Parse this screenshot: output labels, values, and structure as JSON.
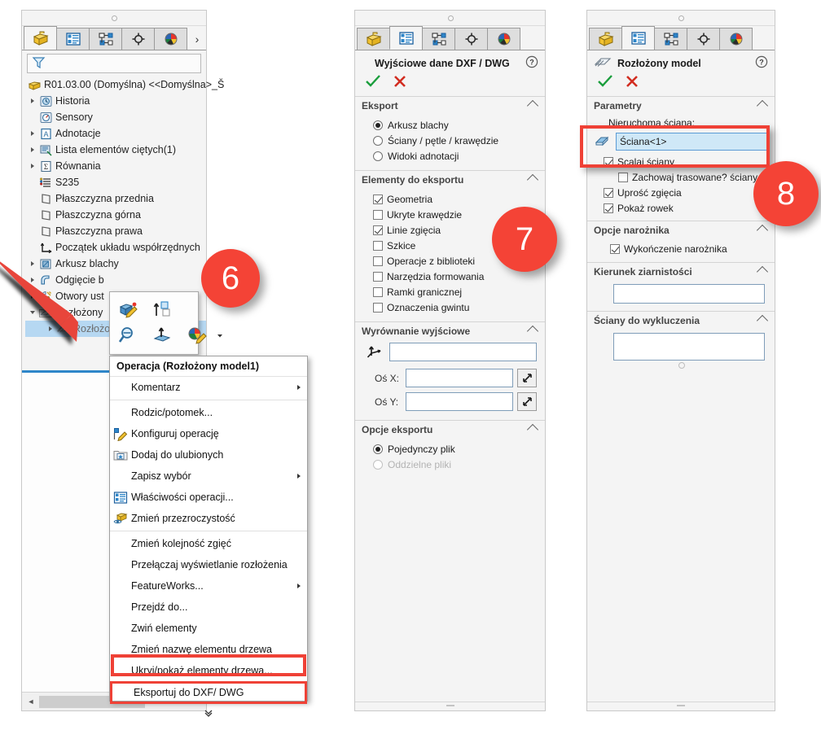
{
  "tree_panel": {
    "tabs": [
      {
        "name": "feature-manager-tab",
        "icon": "feature-tree-icon",
        "active": true
      },
      {
        "name": "property-manager-tab",
        "icon": "property-manager-icon",
        "active": false
      },
      {
        "name": "configuration-manager-tab",
        "icon": "configuration-manager-icon",
        "active": false
      },
      {
        "name": "dimxpert-manager-tab",
        "icon": "dimxpert-icon",
        "active": false
      },
      {
        "name": "display-manager-tab",
        "icon": "display-manager-icon",
        "active": false
      }
    ],
    "more_label": "›",
    "filter_placeholder": "",
    "root_label": "R01.03.00 (Domyślna) <<Domyślna>_Š",
    "items": [
      {
        "label": "Historia",
        "icon": "history-icon",
        "expandable": true,
        "indent": 0
      },
      {
        "label": "Sensory",
        "icon": "sensors-icon",
        "expandable": false,
        "indent": 0
      },
      {
        "label": "Adnotacje",
        "icon": "annotations-icon",
        "expandable": true,
        "indent": 0
      },
      {
        "label": "Lista elementów ciętych(1)",
        "icon": "cut-list-icon",
        "expandable": true,
        "indent": 0
      },
      {
        "label": "Równania",
        "icon": "equations-icon",
        "expandable": true,
        "indent": 0
      },
      {
        "label": "S235",
        "icon": "material-icon",
        "expandable": false,
        "indent": 0
      },
      {
        "label": "Płaszczyzna przednia",
        "icon": "plane-icon",
        "expandable": false,
        "indent": 0
      },
      {
        "label": "Płaszczyzna górna",
        "icon": "plane-icon",
        "expandable": false,
        "indent": 0
      },
      {
        "label": "Płaszczyzna prawa",
        "icon": "plane-icon",
        "expandable": false,
        "indent": 0
      },
      {
        "label": "Początek układu współrzędnych",
        "icon": "origin-icon",
        "expandable": false,
        "indent": 0
      },
      {
        "label": "Arkusz blachy",
        "icon": "sheet-metal-icon",
        "expandable": true,
        "indent": 0
      },
      {
        "label": "Odgięcie b",
        "icon": "base-flange-icon",
        "expandable": true,
        "indent": 0
      },
      {
        "label": "Otwory ust",
        "icon": "hole-wizard-icon",
        "expandable": true,
        "indent": 0
      },
      {
        "label": "Rozłożony",
        "icon": "flat-pattern-folder-icon",
        "expandable": true,
        "expanded": true,
        "indent": 0
      },
      {
        "label": "Rozłożony model1",
        "icon": "flat-pattern-icon",
        "expandable": true,
        "indent": 1,
        "selected": true
      }
    ]
  },
  "mini_toolbar": {
    "buttons": [
      {
        "name": "edit-feature-button",
        "icon": "edit-feature-icon"
      },
      {
        "name": "parent-child-button",
        "icon": "parent-child-icon"
      },
      {
        "name": "zoom-to-selection-button",
        "icon": "zoom-to-selection-icon"
      },
      {
        "name": "normal-to-button",
        "icon": "normal-to-icon"
      },
      {
        "name": "appearance-button",
        "icon": "appearance-icon"
      },
      {
        "name": "appearance-dropdown-button",
        "icon": "chevron-down-icon"
      }
    ]
  },
  "context_menu": {
    "header": "Operacja (Rozłożony model1)",
    "items": [
      {
        "label": "Komentarz",
        "icon": null,
        "submenu": true
      },
      {
        "label": "Rodzic/potomek...",
        "icon": null,
        "submenu": false,
        "sep_before": true
      },
      {
        "label": "Konfiguruj operację",
        "icon": "configure-feature-icon",
        "submenu": false
      },
      {
        "label": "Dodaj do ulubionych",
        "icon": "add-favorite-icon",
        "submenu": false
      },
      {
        "label": "Zapisz wybór",
        "icon": null,
        "submenu": true
      },
      {
        "label": "Właściwości operacji...",
        "icon": "feature-properties-icon",
        "submenu": false
      },
      {
        "label": "Zmień przezroczystość",
        "icon": "change-transparency-icon",
        "submenu": false
      },
      {
        "label": "Zmień kolejność zgięć",
        "icon": null,
        "submenu": false,
        "sep_before": true
      },
      {
        "label": "Przełączaj wyświetlanie rozłożenia",
        "icon": null,
        "submenu": false
      },
      {
        "label": "FeatureWorks...",
        "icon": null,
        "submenu": true
      },
      {
        "label": "Przejdź do...",
        "icon": null,
        "submenu": false
      },
      {
        "label": "Zwiń elementy",
        "icon": null,
        "submenu": false
      },
      {
        "label": "Zmień nazwę elementu drzewa",
        "icon": null,
        "submenu": false
      },
      {
        "label": "Ukryj/pokaż elementy drzewa...",
        "icon": null,
        "submenu": false
      },
      {
        "label": "Eksportuj do DXF/ DWG",
        "icon": null,
        "submenu": false,
        "highlighted": true
      }
    ],
    "expand_glyph": "»"
  },
  "dxf_panel": {
    "tabs": [
      {
        "name": "feature-manager-tab",
        "icon": "feature-tree-icon",
        "active": false
      },
      {
        "name": "property-manager-tab",
        "icon": "property-manager-icon",
        "active": true
      },
      {
        "name": "configuration-manager-tab",
        "icon": "configuration-manager-icon",
        "active": false
      },
      {
        "name": "dimxpert-manager-tab",
        "icon": "dimxpert-icon",
        "active": false
      },
      {
        "name": "display-manager-tab",
        "icon": "display-manager-icon",
        "active": false
      }
    ],
    "title": "Wyjściowe dane DXF / DWG",
    "help_icon": "help-icon",
    "ok_icon": "checkmark-icon",
    "cancel_icon": "close-icon",
    "sections": [
      {
        "title": "Eksport",
        "type": "radio",
        "options": [
          {
            "label": "Arkusz blachy",
            "checked": true
          },
          {
            "label": "Ściany / pętle / krawędzie",
            "checked": false
          },
          {
            "label": "Widoki adnotacji",
            "checked": false
          }
        ]
      },
      {
        "title": "Elementy do eksportu",
        "type": "check",
        "options": [
          {
            "label": "Geometria",
            "checked": true
          },
          {
            "label": "Ukryte krawędzie",
            "checked": false
          },
          {
            "label": "Linie zgięcia",
            "checked": true
          },
          {
            "label": "Szkice",
            "checked": false
          },
          {
            "label": "Operacje z biblioteki",
            "checked": false
          },
          {
            "label": "Narzędzia formowania",
            "checked": false
          },
          {
            "label": "Ramki granicznej",
            "checked": false
          },
          {
            "label": "Oznaczenia gwintu",
            "checked": false
          }
        ]
      },
      {
        "title": "Wyrównanie wyjściowe",
        "type": "alignment",
        "entity_value": "",
        "fields": [
          {
            "label": "Oś X:",
            "value": ""
          },
          {
            "label": "Oś Y:",
            "value": ""
          }
        ]
      },
      {
        "title": "Opcje eksportu",
        "type": "radio",
        "options": [
          {
            "label": "Pojedynczy plik",
            "checked": true,
            "disabled": false
          },
          {
            "label": "Oddzielne pliki",
            "checked": false,
            "disabled": true
          }
        ]
      }
    ]
  },
  "flat_panel": {
    "tabs": [
      {
        "name": "feature-manager-tab",
        "icon": "feature-tree-icon",
        "active": false
      },
      {
        "name": "property-manager-tab",
        "icon": "property-manager-icon",
        "active": true
      },
      {
        "name": "configuration-manager-tab",
        "icon": "configuration-manager-icon",
        "active": false
      },
      {
        "name": "dimxpert-manager-tab",
        "icon": "dimxpert-icon",
        "active": false
      },
      {
        "name": "display-manager-tab",
        "icon": "display-manager-icon",
        "active": false
      }
    ],
    "title": "Rozłożony model",
    "title_icon": "flat-pattern-icon",
    "help_icon": "help-icon",
    "ok_icon": "checkmark-icon",
    "cancel_icon": "close-icon",
    "parametry": {
      "title": "Parametry",
      "fixed_face_label": "Nieruchoma ściana:",
      "fixed_face_value": "Ściana<1>",
      "checks": [
        {
          "label": "Scalaj ściany",
          "checked": true,
          "indent": 0
        },
        {
          "label": "Zachowaj trasowane? ściany",
          "checked": false,
          "indent": 1
        },
        {
          "label": "Uprość zgięcia",
          "checked": true,
          "indent": 0
        },
        {
          "label": "Pokaż rowek",
          "checked": true,
          "indent": 0
        }
      ]
    },
    "corner": {
      "title": "Opcje narożnika",
      "checks": [
        {
          "label": "Wykończenie narożnika",
          "checked": true
        }
      ]
    },
    "grain": {
      "title": "Kierunek ziarnistości",
      "value": ""
    },
    "exclude": {
      "title": "Ściany do wykluczenia",
      "value": ""
    }
  },
  "annotations": {
    "badges": [
      {
        "label": "6",
        "name": "step-badge-6"
      },
      {
        "label": "7",
        "name": "step-badge-7"
      },
      {
        "label": "8",
        "name": "step-badge-8"
      }
    ],
    "accent_red": "#ef4136",
    "badge_red": "#f44336",
    "arrow_red": "#e8443a"
  }
}
